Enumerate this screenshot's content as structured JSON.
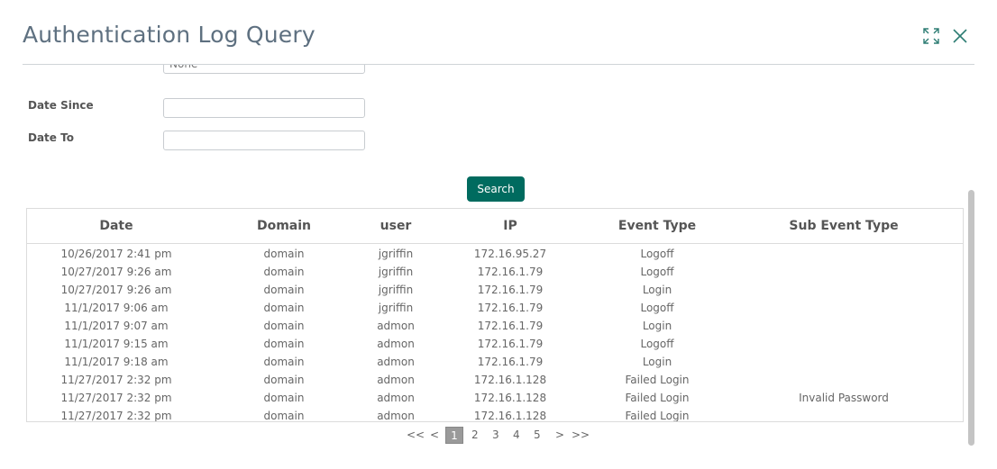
{
  "dialog": {
    "title": "Authentication Log Query"
  },
  "form": {
    "partial_field_value": "None",
    "date_since_label": "Date Since",
    "date_to_label": "Date To",
    "date_since_value": "",
    "date_to_value": ""
  },
  "search_label": "Search",
  "table": {
    "headers": [
      "Date",
      "Domain",
      "user",
      "IP",
      "Event Type",
      "Sub Event Type"
    ],
    "rows": [
      [
        "10/26/2017 2:41 pm",
        "domain",
        "jgriffin",
        "172.16.95.27",
        "Logoff",
        ""
      ],
      [
        "10/27/2017 9:26 am",
        "domain",
        "jgriffin",
        "172.16.1.79",
        "Logoff",
        ""
      ],
      [
        "10/27/2017 9:26 am",
        "domain",
        "jgriffin",
        "172.16.1.79",
        "Login",
        ""
      ],
      [
        "11/1/2017 9:06 am",
        "domain",
        "jgriffin",
        "172.16.1.79",
        "Logoff",
        ""
      ],
      [
        "11/1/2017 9:07 am",
        "domain",
        "admon",
        "172.16.1.79",
        "Login",
        ""
      ],
      [
        "11/1/2017 9:15 am",
        "domain",
        "admon",
        "172.16.1.79",
        "Logoff",
        ""
      ],
      [
        "11/1/2017 9:18 am",
        "domain",
        "admon",
        "172.16.1.79",
        "Login",
        ""
      ],
      [
        "11/27/2017 2:32 pm",
        "domain",
        "admon",
        "172.16.1.128",
        "Failed Login",
        ""
      ],
      [
        "11/27/2017 2:32 pm",
        "domain",
        "admon",
        "172.16.1.128",
        "Failed Login",
        "Invalid Password"
      ],
      [
        "11/27/2017 2:32 pm",
        "domain",
        "admon",
        "172.16.1.128",
        "Failed Login",
        ""
      ]
    ]
  },
  "pager": {
    "first": "<<",
    "prev": "<",
    "pages": [
      "1",
      "2",
      "3",
      "4",
      "5"
    ],
    "current_page": "1",
    "next": ">",
    "last": ">>"
  },
  "colors": {
    "accent": "#006b5f",
    "title": "#5e7080",
    "current_page_bg": "#9a9a9a"
  },
  "icons": {
    "expand": "expand-icon",
    "close": "close-icon"
  }
}
